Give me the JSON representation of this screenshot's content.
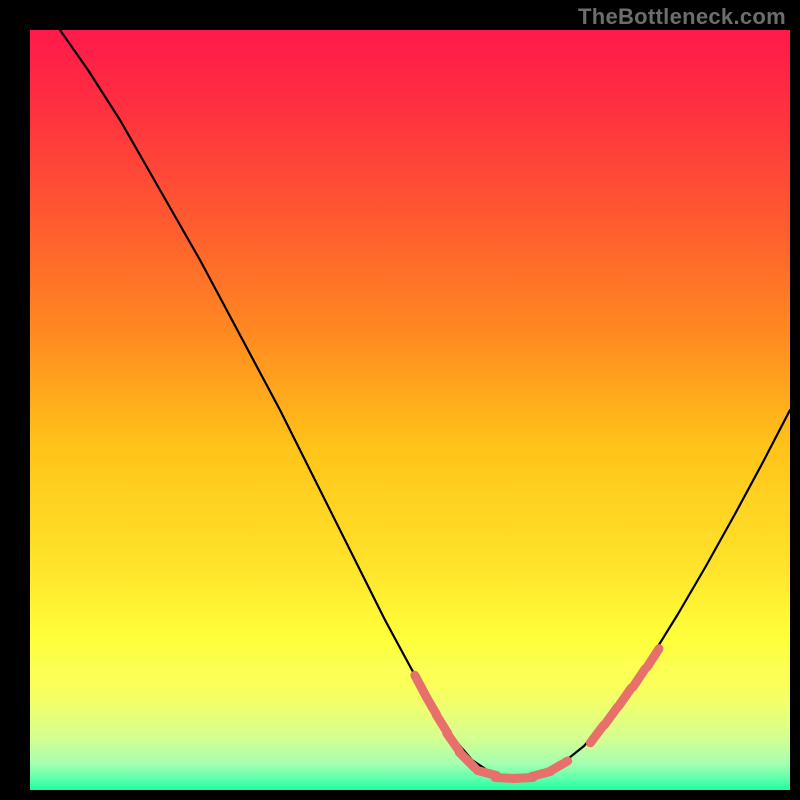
{
  "watermark": "TheBottleneck.com",
  "colors": {
    "frame": "#000000",
    "curve": "#000000",
    "marker": "#e7706a",
    "gradient_stops": [
      {
        "offset": 0.0,
        "color": "#ff1a4a"
      },
      {
        "offset": 0.1,
        "color": "#ff2f40"
      },
      {
        "offset": 0.25,
        "color": "#ff5a30"
      },
      {
        "offset": 0.4,
        "color": "#ff8a20"
      },
      {
        "offset": 0.55,
        "color": "#ffc419"
      },
      {
        "offset": 0.7,
        "color": "#ffe22a"
      },
      {
        "offset": 0.8,
        "color": "#ffff3a"
      },
      {
        "offset": 0.88,
        "color": "#f4ff66"
      },
      {
        "offset": 0.93,
        "color": "#d6ff8f"
      },
      {
        "offset": 0.965,
        "color": "#a6ffb0"
      },
      {
        "offset": 0.985,
        "color": "#5effad"
      },
      {
        "offset": 1.0,
        "color": "#1aff9d"
      }
    ]
  },
  "chart_data": {
    "type": "line",
    "title": "",
    "xlabel": "",
    "ylabel": "",
    "xlim": [
      30,
      790
    ],
    "ylim": [
      30,
      790
    ],
    "curve": [
      {
        "x": 60,
        "y": 30
      },
      {
        "x": 88,
        "y": 70
      },
      {
        "x": 120,
        "y": 120
      },
      {
        "x": 160,
        "y": 190
      },
      {
        "x": 200,
        "y": 260
      },
      {
        "x": 240,
        "y": 335
      },
      {
        "x": 280,
        "y": 410
      },
      {
        "x": 320,
        "y": 490
      },
      {
        "x": 355,
        "y": 560
      },
      {
        "x": 385,
        "y": 620
      },
      {
        "x": 412,
        "y": 670
      },
      {
        "x": 436,
        "y": 710
      },
      {
        "x": 455,
        "y": 740
      },
      {
        "x": 472,
        "y": 760
      },
      {
        "x": 490,
        "y": 772
      },
      {
        "x": 508,
        "y": 778
      },
      {
        "x": 526,
        "y": 778
      },
      {
        "x": 545,
        "y": 773
      },
      {
        "x": 564,
        "y": 762
      },
      {
        "x": 584,
        "y": 746
      },
      {
        "x": 605,
        "y": 722
      },
      {
        "x": 628,
        "y": 692
      },
      {
        "x": 652,
        "y": 656
      },
      {
        "x": 678,
        "y": 614
      },
      {
        "x": 706,
        "y": 566
      },
      {
        "x": 735,
        "y": 514
      },
      {
        "x": 763,
        "y": 462
      },
      {
        "x": 790,
        "y": 410
      }
    ],
    "markers_left": [
      {
        "x": 420,
        "y": 685,
        "len": 22,
        "angle": 62
      },
      {
        "x": 431,
        "y": 705,
        "len": 22,
        "angle": 60
      },
      {
        "x": 442,
        "y": 724,
        "len": 22,
        "angle": 58
      },
      {
        "x": 453,
        "y": 742,
        "len": 22,
        "angle": 55
      },
      {
        "x": 467,
        "y": 760,
        "len": 22,
        "angle": 45
      }
    ],
    "markers_bottom": [
      {
        "x": 487,
        "y": 773,
        "len": 20,
        "angle": 15
      },
      {
        "x": 505,
        "y": 778,
        "len": 20,
        "angle": 3
      },
      {
        "x": 523,
        "y": 778,
        "len": 20,
        "angle": -3
      },
      {
        "x": 541,
        "y": 774,
        "len": 20,
        "angle": -15
      },
      {
        "x": 559,
        "y": 766,
        "len": 20,
        "angle": -30
      }
    ],
    "markers_right": [
      {
        "x": 597,
        "y": 734,
        "len": 22,
        "angle": -53
      },
      {
        "x": 611,
        "y": 716,
        "len": 22,
        "angle": -54
      },
      {
        "x": 625,
        "y": 697,
        "len": 22,
        "angle": -55
      },
      {
        "x": 639,
        "y": 678,
        "len": 22,
        "angle": -56
      },
      {
        "x": 653,
        "y": 658,
        "len": 22,
        "angle": -57
      }
    ]
  }
}
